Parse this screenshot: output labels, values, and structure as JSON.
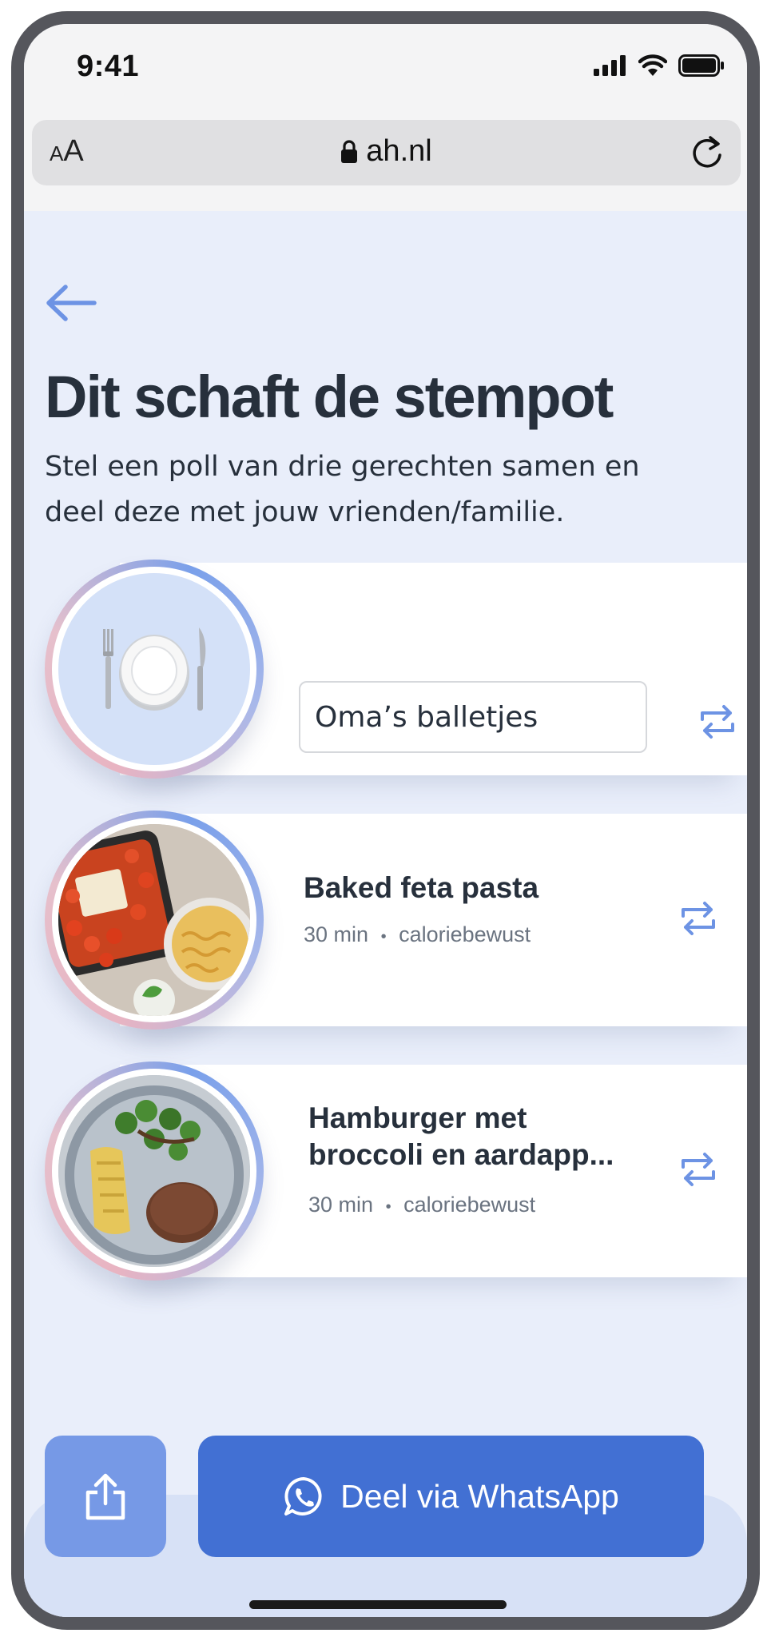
{
  "status": {
    "time": "9:41",
    "icons": [
      "signal-icon",
      "wifi-icon",
      "battery-icon"
    ]
  },
  "browser": {
    "text_size_label_small": "A",
    "text_size_label_large": "A",
    "url": "ah.nl",
    "icons": [
      "lock-icon",
      "reload-icon"
    ]
  },
  "page": {
    "title": "Dit schaft de stempot",
    "subtitle": "Stel een poll van drie gerechten samen en deel deze met jouw vrienden/familie."
  },
  "poll": {
    "custom_dish": {
      "value": "Oma’s balletjes",
      "icon": "fork-knife-plate-icon"
    },
    "recipes": [
      {
        "name": "Baked feta pasta",
        "time": "30 min",
        "separator": "•",
        "tag": "caloriebewust"
      },
      {
        "name": "Hamburger met broccoli en aardapp...",
        "time": "30 min",
        "separator": "•",
        "tag": "caloriebewust"
      }
    ]
  },
  "actions": {
    "share_icon": "share-icon",
    "whatsapp_label": "Deel via WhatsApp"
  },
  "colors": {
    "accent": "#4270d3",
    "accent_light": "#7699e6",
    "background": "#e9eefa",
    "text": "#27303c",
    "muted": "#6a7380"
  }
}
